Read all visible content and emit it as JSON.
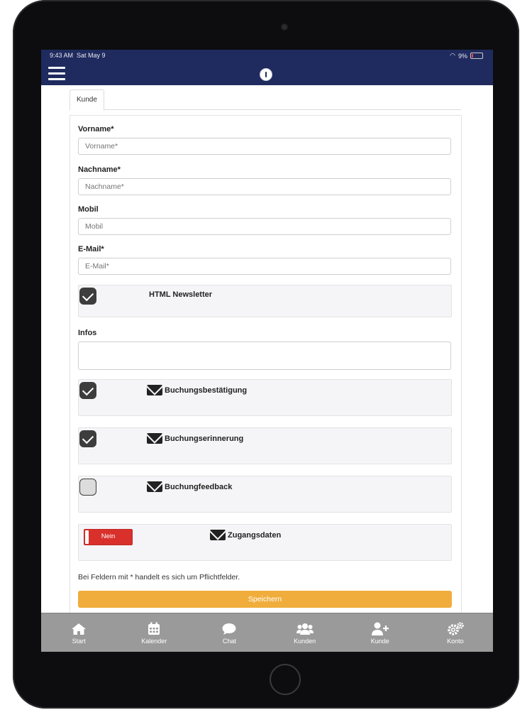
{
  "status_bar": {
    "time": "9:43 AM",
    "date": "Sat May 9",
    "battery": "9%"
  },
  "tabs": [
    {
      "label": "Kunde"
    }
  ],
  "form": {
    "fields": [
      {
        "label": "Vorname*",
        "placeholder": "Vorname*"
      },
      {
        "label": "Nachname*",
        "placeholder": "Nachname*"
      },
      {
        "label": "Mobil",
        "placeholder": "Mobil"
      },
      {
        "label": "E-Mail*",
        "placeholder": "E-Mail*"
      }
    ],
    "newsletter": {
      "label": "HTML Newsletter",
      "checked": true
    },
    "infos": {
      "label": "Infos",
      "value": ""
    },
    "notifications": [
      {
        "label": "Buchungsbestätigung",
        "checked": true,
        "icon": "envelope-icon"
      },
      {
        "label": "Buchungserinnerung",
        "checked": true,
        "icon": "envelope-icon"
      },
      {
        "label": "Buchungfeedback",
        "checked": false,
        "icon": "envelope-icon"
      }
    ],
    "access": {
      "toggle_label": "Nein",
      "label": "Zugangsdaten",
      "toggle_color": "#d9302c"
    },
    "hint": "Bei Feldern mit * handelt es sich um Pflichtfelder.",
    "save_label": "Speichern"
  },
  "tab_bar": [
    {
      "label": "Start",
      "icon": "home-icon"
    },
    {
      "label": "Kalender",
      "icon": "calendar-icon"
    },
    {
      "label": "Chat",
      "icon": "chat-icon"
    },
    {
      "label": "Kunden",
      "icon": "users-icon"
    },
    {
      "label": "Kunde",
      "icon": "add-user-icon"
    },
    {
      "label": "Konto",
      "icon": "gears-icon"
    }
  ],
  "colors": {
    "nav": "#1f2a5e",
    "accent": "#f0ad3c",
    "tab_bar": "#9a9a9a",
    "danger": "#d9302c"
  }
}
